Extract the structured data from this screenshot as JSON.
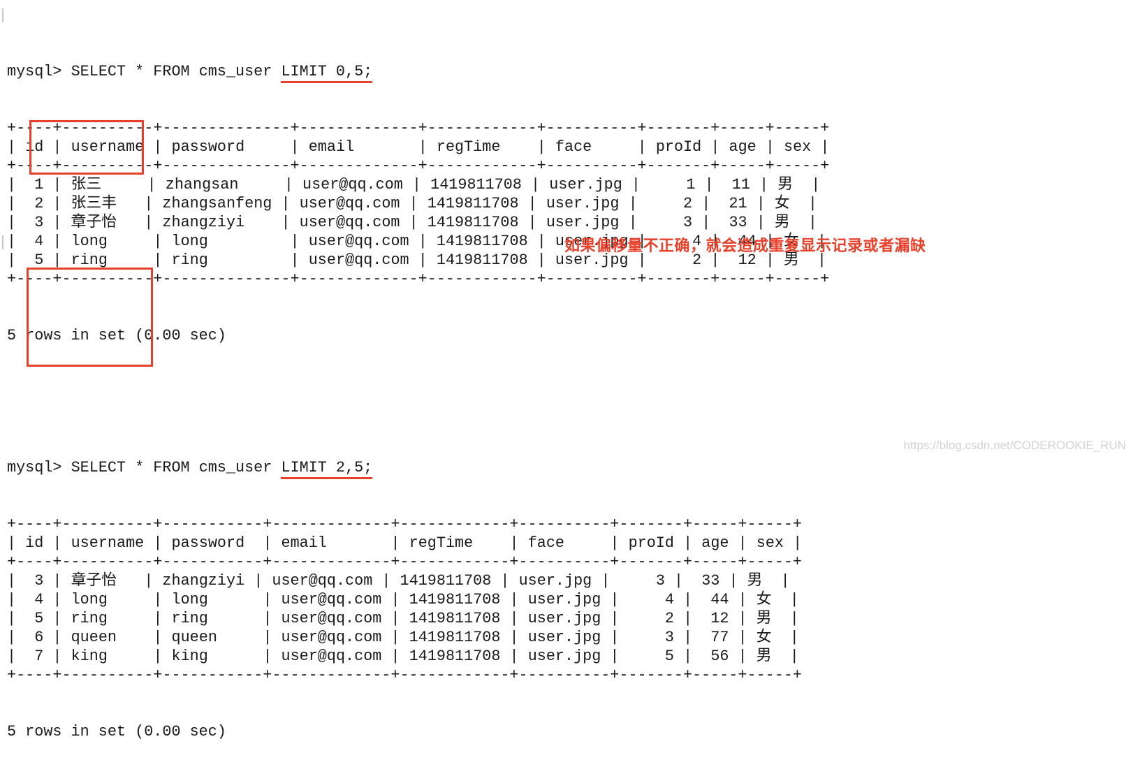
{
  "prompt": "mysql>",
  "queries": [
    {
      "command_prefix": "SELECT * FROM cms_user ",
      "command_highlight": "LIMIT 0,5;",
      "columns": [
        "id",
        "username",
        "password",
        "email",
        "regTime",
        "face",
        "proId",
        "age",
        "sex"
      ],
      "rows": [
        [
          "1",
          "张三",
          "zhangsan",
          "user@qq.com",
          "1419811708",
          "user.jpg",
          "1",
          "11",
          "男"
        ],
        [
          "2",
          "张三丰",
          "zhangsanfeng",
          "user@qq.com",
          "1419811708",
          "user.jpg",
          "2",
          "21",
          "女"
        ],
        [
          "3",
          "章子怡",
          "zhangziyi",
          "user@qq.com",
          "1419811708",
          "user.jpg",
          "3",
          "33",
          "男"
        ],
        [
          "4",
          "long",
          "long",
          "user@qq.com",
          "1419811708",
          "user.jpg",
          "4",
          "44",
          "女"
        ],
        [
          "5",
          "ring",
          "ring",
          "user@qq.com",
          "1419811708",
          "user.jpg",
          "2",
          "12",
          "男"
        ]
      ],
      "footer": "5 rows in set (0.00 sec)"
    },
    {
      "command_prefix": "SELECT * FROM cms_user ",
      "command_highlight": "LIMIT 2,5;",
      "columns": [
        "id",
        "username",
        "password",
        "email",
        "regTime",
        "face",
        "proId",
        "age",
        "sex"
      ],
      "rows": [
        [
          "3",
          "章子怡",
          "zhangziyi",
          "user@qq.com",
          "1419811708",
          "user.jpg",
          "3",
          "33",
          "男"
        ],
        [
          "4",
          "long",
          "long",
          "user@qq.com",
          "1419811708",
          "user.jpg",
          "4",
          "44",
          "女"
        ],
        [
          "5",
          "ring",
          "ring",
          "user@qq.com",
          "1419811708",
          "user.jpg",
          "2",
          "12",
          "男"
        ],
        [
          "6",
          "queen",
          "queen",
          "user@qq.com",
          "1419811708",
          "user.jpg",
          "3",
          "77",
          "女"
        ],
        [
          "7",
          "king",
          "king",
          "user@qq.com",
          "1419811708",
          "user.jpg",
          "5",
          "56",
          "男"
        ]
      ],
      "footer": "5 rows in set (0.00 sec)"
    }
  ],
  "annotation": "如果偏移量不正确，就会造成重复显示记录或者漏缺",
  "watermark": "https://blog.csdn.net/CODEROOKIE_RUN",
  "colors": {
    "highlight": "#e8412b",
    "text": "#1a1a1a",
    "background": "#ffffff"
  }
}
